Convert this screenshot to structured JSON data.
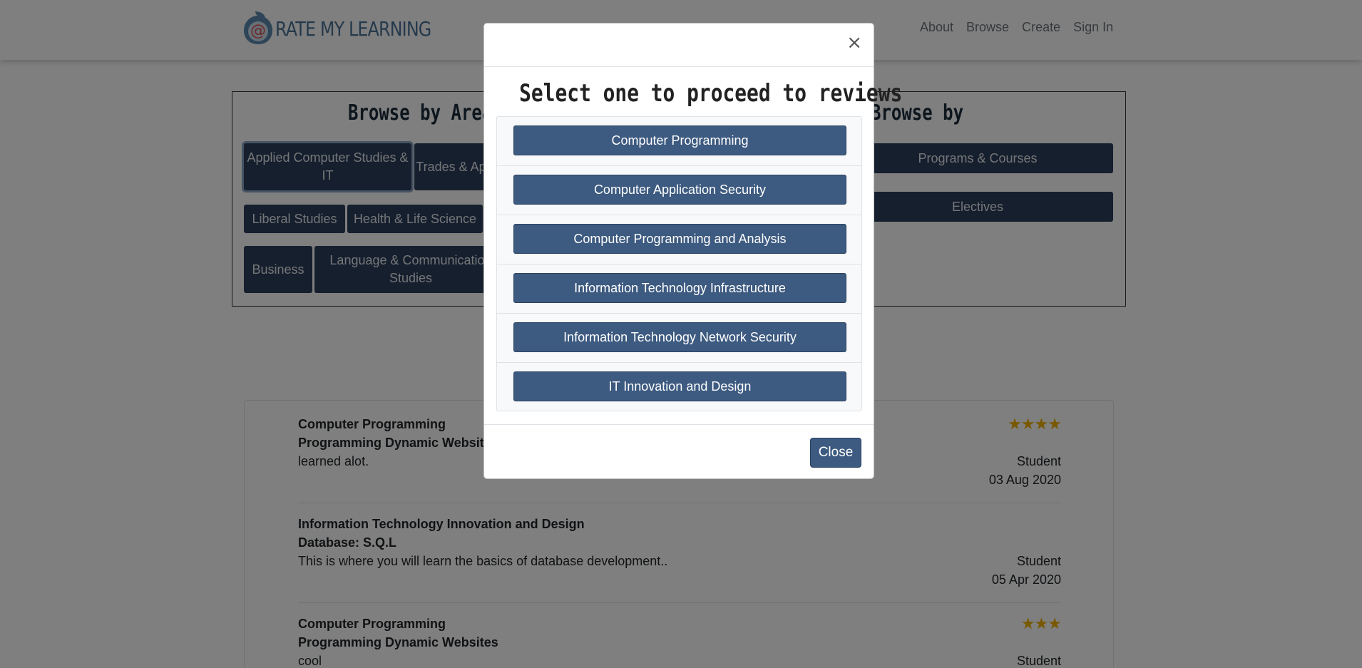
{
  "navbar": {
    "logo_text": "RATE MY LEARNING",
    "links": [
      "About",
      "Browse",
      "Create",
      "Sign In"
    ]
  },
  "browse": {
    "areas_title": "Browse by Areas of Study",
    "by_title": "Browse by",
    "area_buttons": [
      "Applied Computer Studies & IT",
      "Trades & Apprenticeship",
      "Liberal Studies",
      "Health & Life Science",
      "Business",
      "Language & Communication Studies"
    ],
    "by_buttons": [
      "Programs & Courses",
      "Electives"
    ]
  },
  "reviews": [
    {
      "program": "Computer Programming",
      "course": "Programming Dynamic Websites",
      "comment": "learned alot.",
      "stars": "★★★★",
      "rating": 4,
      "author": "Student",
      "date": "03 Aug 2020"
    },
    {
      "program": "Information Technology Innovation and Design",
      "course": "Database: S.Q.L",
      "comment": "This is where you will learn the basics of database development..",
      "stars": "",
      "rating": 0,
      "author": "Student",
      "date": "05 Apr 2020"
    },
    {
      "program": "Computer Programming",
      "course": "Programming Dynamic Websites",
      "comment": "cool",
      "stars": "★★★",
      "rating": 3,
      "author": "Student",
      "date": ""
    }
  ],
  "modal": {
    "close_x": "×",
    "title": "Select one to proceed to reviews",
    "programs": [
      "Computer Programming",
      "Computer Application Security",
      "Computer Programming and Analysis",
      "Information Technology Infrastructure",
      "Information Technology Network Security",
      "IT Innovation and Design"
    ],
    "close_label": "Close"
  }
}
